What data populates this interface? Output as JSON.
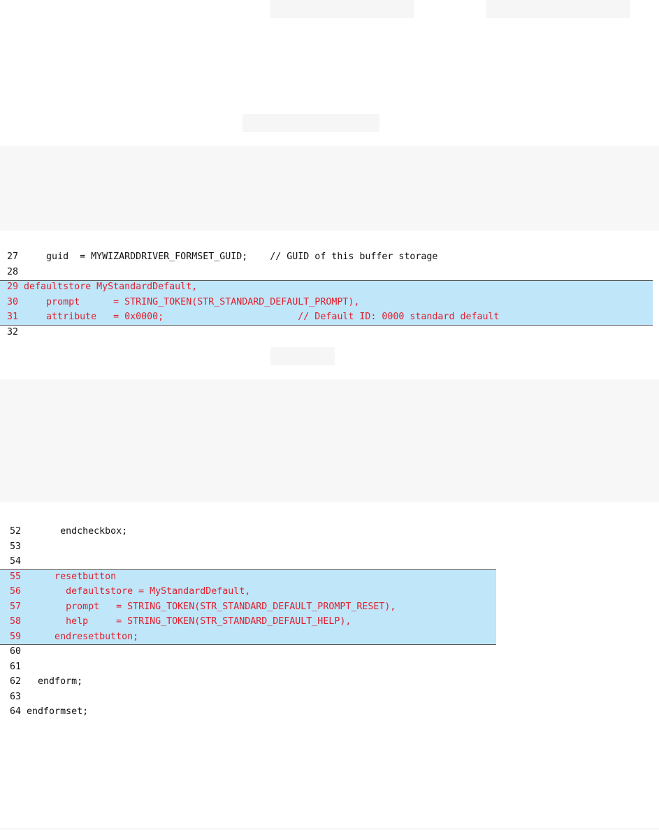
{
  "snippet1": {
    "lines": [
      {
        "n": "27",
        "code": "    guid  = MYWIZARDDRIVER_FORMSET_GUID;    // GUID of this buffer storage",
        "highlight": false
      },
      {
        "n": "28",
        "code": "",
        "highlight": false
      },
      {
        "n": "29",
        "code": "defaultstore MyStandardDefault,",
        "highlight": true
      },
      {
        "n": "30",
        "code": "    prompt      = STRING_TOKEN(STR_STANDARD_DEFAULT_PROMPT),",
        "highlight": true
      },
      {
        "n": "31",
        "code": "    attribute   = 0x0000;                        // Default ID: 0000 standard default",
        "highlight": true
      },
      {
        "n": "32",
        "code": "",
        "highlight": false
      }
    ]
  },
  "snippet2": {
    "lines": [
      {
        "n": "52",
        "code": "      endcheckbox;",
        "highlight": false
      },
      {
        "n": "53",
        "code": "",
        "highlight": false
      },
      {
        "n": "54",
        "code": "",
        "highlight": false
      },
      {
        "n": "55",
        "code": "     resetbutton",
        "highlight": true
      },
      {
        "n": "56",
        "code": "       defaultstore = MyStandardDefault,",
        "highlight": true
      },
      {
        "n": "57",
        "code": "       prompt   = STRING_TOKEN(STR_STANDARD_DEFAULT_PROMPT_RESET),",
        "highlight": true
      },
      {
        "n": "58",
        "code": "       help     = STRING_TOKEN(STR_STANDARD_DEFAULT_HELP),",
        "highlight": true
      },
      {
        "n": "59",
        "code": "     endresetbutton;",
        "highlight": true
      },
      {
        "n": "60",
        "code": "",
        "highlight": false
      },
      {
        "n": "61",
        "code": "",
        "highlight": false
      },
      {
        "n": "62",
        "code": "  endform;",
        "highlight": false
      },
      {
        "n": "63",
        "code": "",
        "highlight": false
      },
      {
        "n": "64",
        "code": "endformset;",
        "highlight": false
      }
    ]
  },
  "colors": {
    "highlight_bg": "#bfe6f9",
    "highlight_text": "#e0202e",
    "normal_text": "#111111",
    "placeholder": "#f6f6f6"
  }
}
